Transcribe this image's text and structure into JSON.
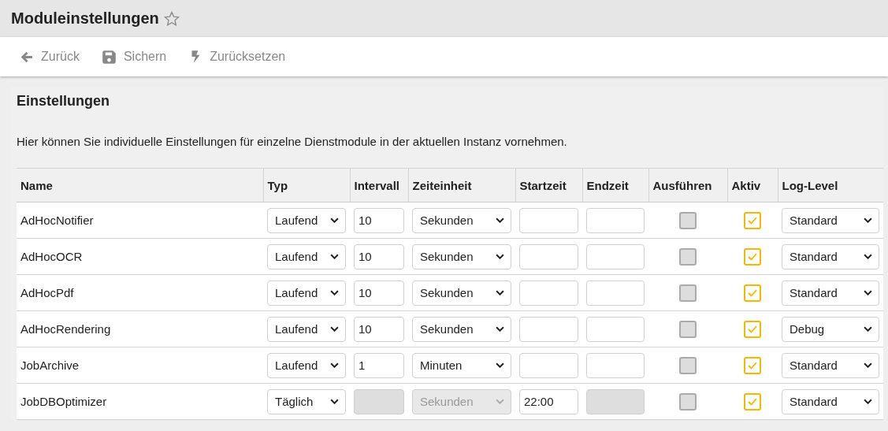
{
  "page": {
    "title": "Moduleinstellungen",
    "favorite": false
  },
  "toolbar": [
    {
      "kind": "back",
      "label": "Zurück"
    },
    {
      "kind": "save",
      "label": "Sichern"
    },
    {
      "kind": "reset",
      "label": "Zurücksetzen"
    }
  ],
  "panel": {
    "title": "Einstellungen",
    "description": "Hier können Sie individuelle Einstellungen für einzelne Dienstmodule in der aktuellen Instanz vornehmen."
  },
  "table": {
    "columns": [
      "Name",
      "Typ",
      "Intervall",
      "Zeiteinheit",
      "Startzeit",
      "Endzeit",
      "Ausführen",
      "Aktiv",
      "Log-Level"
    ],
    "rows": [
      {
        "name": "AdHocNotifier",
        "typ": "Laufend",
        "intervall": {
          "value": "10",
          "disabled": false
        },
        "zeiteinheit": {
          "value": "Sekunden",
          "disabled": false
        },
        "startzeit": {
          "disabled": false
        },
        "endzeit": {
          "disabled": false
        },
        "ausfuehren": {
          "checked": false
        },
        "aktiv": {
          "checked": true
        },
        "log_level": "Standard"
      },
      {
        "name": "AdHocOCR",
        "typ": "Laufend",
        "intervall": {
          "value": "10",
          "disabled": false
        },
        "zeiteinheit": {
          "value": "Sekunden",
          "disabled": false
        },
        "startzeit": {
          "disabled": false
        },
        "endzeit": {
          "disabled": false
        },
        "ausfuehren": {
          "checked": false
        },
        "aktiv": {
          "checked": true
        },
        "log_level": "Standard"
      },
      {
        "name": "AdHocPdf",
        "typ": "Laufend",
        "intervall": {
          "value": "10",
          "disabled": false
        },
        "zeiteinheit": {
          "value": "Sekunden",
          "disabled": false
        },
        "startzeit": {
          "disabled": false
        },
        "endzeit": {
          "disabled": false
        },
        "ausfuehren": {
          "checked": false
        },
        "aktiv": {
          "checked": true
        },
        "log_level": "Standard"
      },
      {
        "name": "AdHocRendering",
        "typ": "Laufend",
        "intervall": {
          "value": "10",
          "disabled": false
        },
        "zeiteinheit": {
          "value": "Sekunden",
          "disabled": false
        },
        "startzeit": {
          "disabled": false
        },
        "endzeit": {
          "disabled": false
        },
        "ausfuehren": {
          "checked": false
        },
        "aktiv": {
          "checked": true
        },
        "log_level": "Debug"
      },
      {
        "name": "JobArchive",
        "typ": "Laufend",
        "intervall": {
          "value": "1",
          "disabled": false
        },
        "zeiteinheit": {
          "value": "Minuten",
          "disabled": false
        },
        "startzeit": {
          "disabled": false
        },
        "endzeit": {
          "disabled": false
        },
        "ausfuehren": {
          "checked": false
        },
        "aktiv": {
          "checked": true
        },
        "log_level": "Standard"
      },
      {
        "name": "JobDBOptimizer",
        "typ": "Täglich",
        "intervall": {
          "disabled": true
        },
        "zeiteinheit": {
          "value": "Sekunden",
          "disabled": true
        },
        "startzeit": {
          "value": "22:00",
          "disabled": false
        },
        "endzeit": {
          "disabled": true
        },
        "ausfuehren": {
          "checked": false
        },
        "aktiv": {
          "checked": true
        },
        "log_level": "Standard"
      }
    ]
  }
}
